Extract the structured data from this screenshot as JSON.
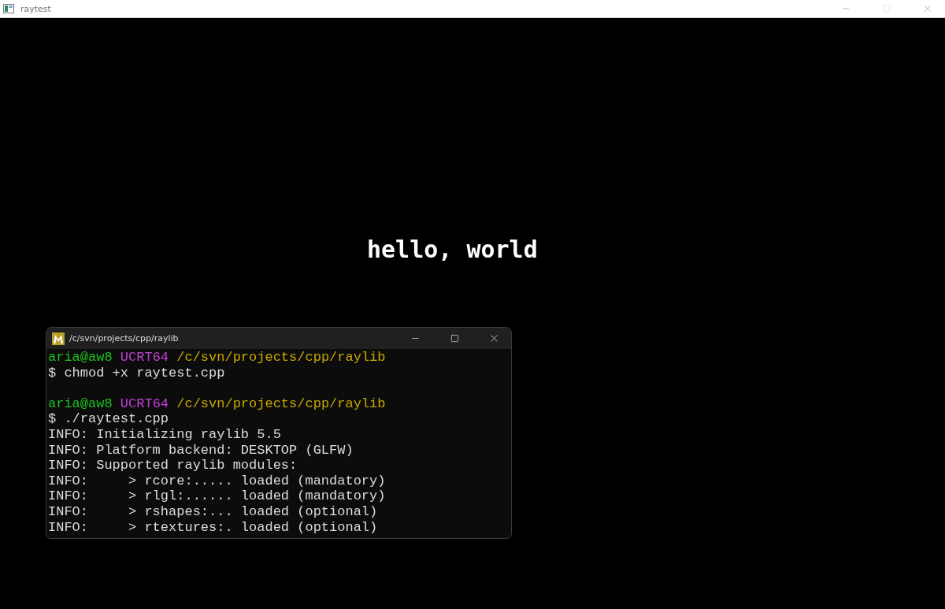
{
  "window": {
    "title": "raytest"
  },
  "canvas_text": "hello, world",
  "terminal": {
    "title": "/c/svn/projects/cpp/raylib",
    "lines": [
      {
        "kind": "prompt",
        "user": "aria@aw8",
        "shell": "UCRT64",
        "path": "/c/svn/projects/cpp/raylib"
      },
      {
        "kind": "output",
        "text": "$ chmod +x raytest.cpp"
      },
      {
        "kind": "blank"
      },
      {
        "kind": "prompt",
        "user": "aria@aw8",
        "shell": "UCRT64",
        "path": "/c/svn/projects/cpp/raylib"
      },
      {
        "kind": "output",
        "text": "$ ./raytest.cpp"
      },
      {
        "kind": "output",
        "text": "INFO: Initializing raylib 5.5"
      },
      {
        "kind": "output",
        "text": "INFO: Platform backend: DESKTOP (GLFW)"
      },
      {
        "kind": "output",
        "text": "INFO: Supported raylib modules:"
      },
      {
        "kind": "output",
        "text": "INFO:     > rcore:..... loaded (mandatory)"
      },
      {
        "kind": "output",
        "text": "INFO:     > rlgl:...... loaded (mandatory)"
      },
      {
        "kind": "output",
        "text": "INFO:     > rshapes:... loaded (optional)"
      },
      {
        "kind": "output",
        "text": "INFO:     > rtextures:. loaded (optional)"
      }
    ]
  }
}
